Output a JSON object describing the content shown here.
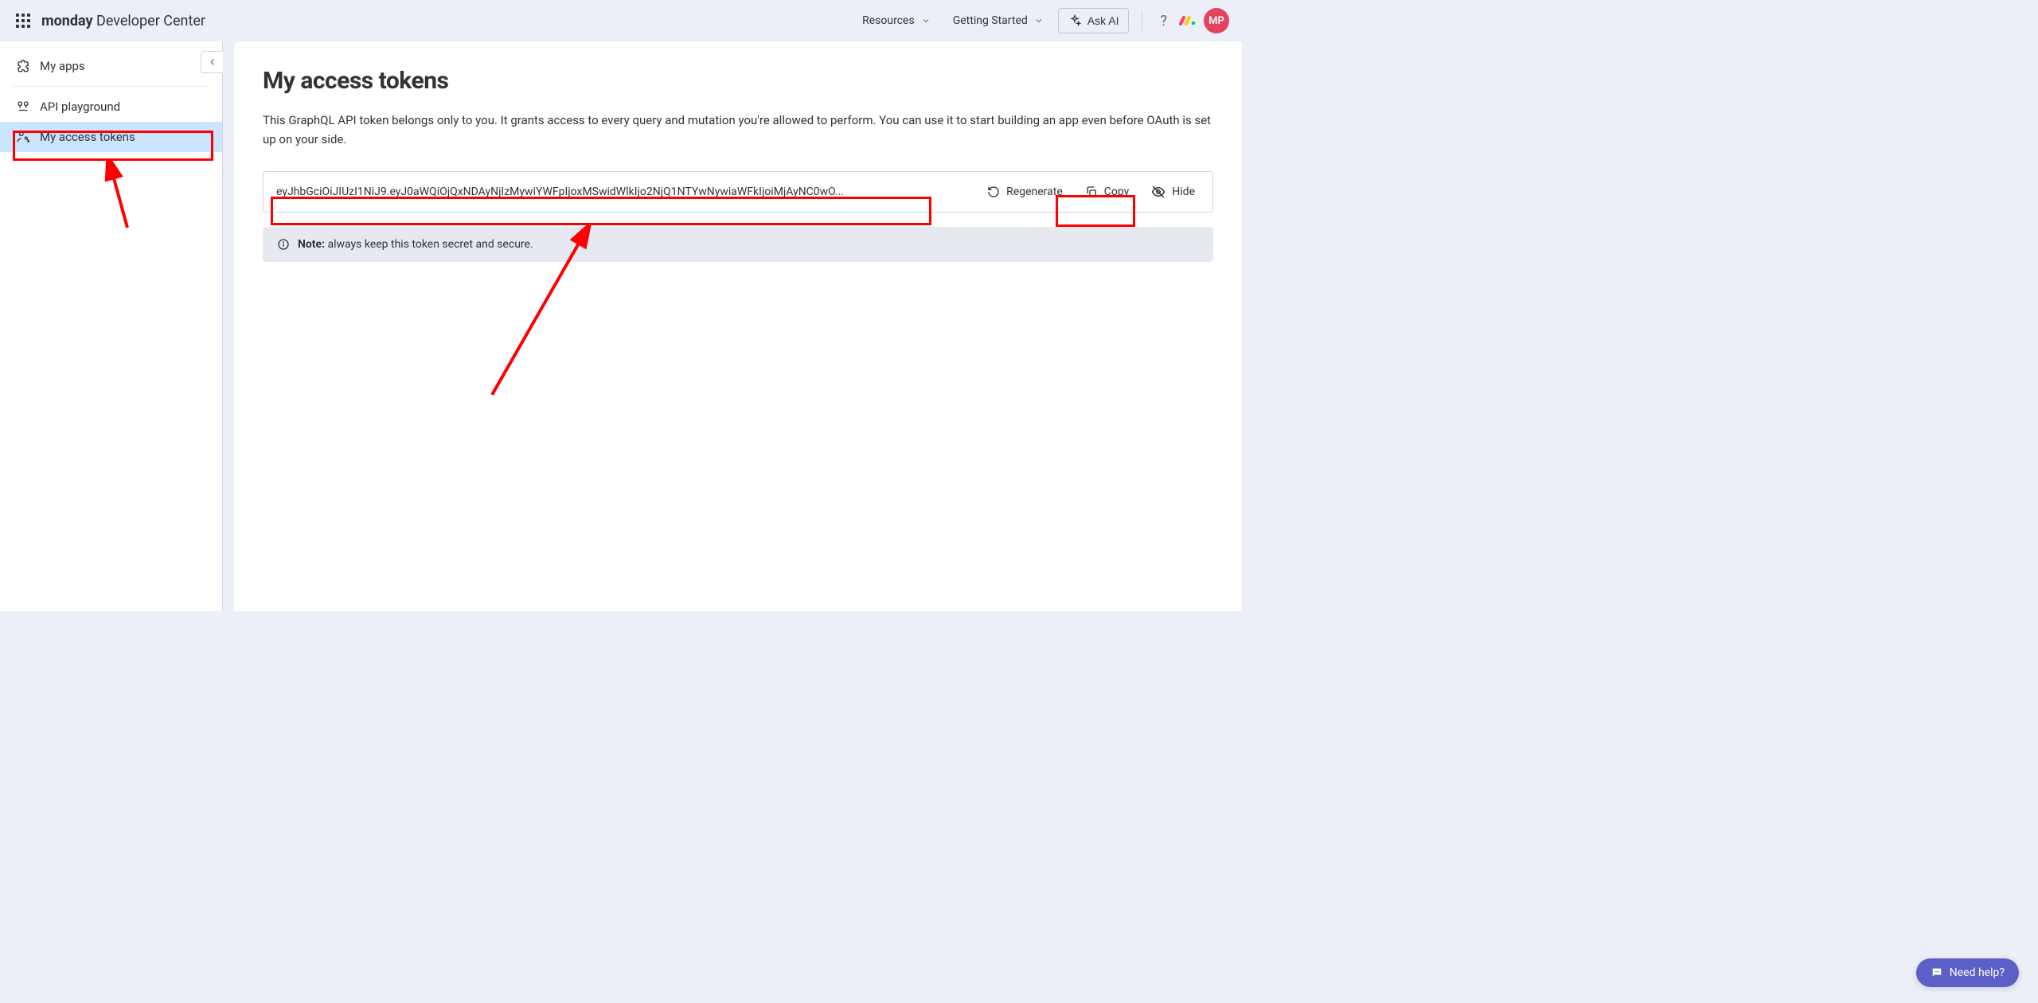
{
  "topbar": {
    "brand_bold": "monday",
    "brand_rest": " Developer Center",
    "resources_label": "Resources",
    "getting_started_label": "Getting Started",
    "ask_ai_label": "Ask AI",
    "help_symbol": "?",
    "avatar_initials": "MP"
  },
  "sidebar": {
    "items": [
      {
        "label": "My apps"
      },
      {
        "label": "API playground"
      },
      {
        "label": "My access tokens"
      }
    ]
  },
  "main": {
    "title": "My access tokens",
    "description": "This GraphQL API token belongs only to you. It grants access to every query and mutation you're allowed to perform. You can use it to start building an app even before OAuth is set up on your side.",
    "token_value": "eyJhbGciOiJIUzI1NiJ9.eyJ0aWQiOjQxNDAyNjIzMywiYWFpIjoxMSwidWlkIjo2NjQ1NTYwNywiaWFkIjoiMjAyNC0wO...",
    "regenerate_label": "Regenerate",
    "copy_label": "Copy",
    "hide_label": "Hide",
    "note_prefix": "Note:",
    "note_text": " always keep this token secret and secure."
  },
  "help_fab": {
    "label": "Need help?"
  },
  "colors": {
    "accent_red": "#ff0000",
    "avatar_bg": "#e2445c",
    "fab_bg": "#5b5fc7",
    "active_bg": "#cce5ff"
  }
}
